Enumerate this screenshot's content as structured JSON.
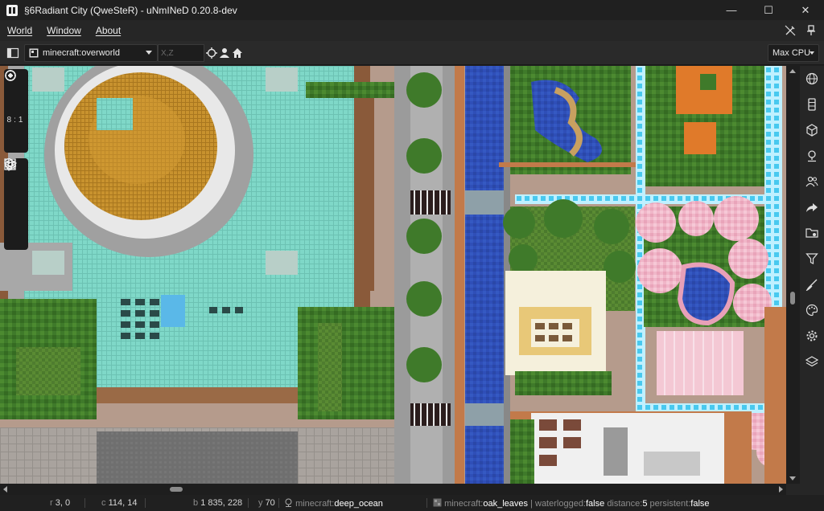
{
  "window": {
    "title": "§6Radiant City (QweSteR) - uNmINeD 0.20.8-dev",
    "controls": {
      "minimize": "—",
      "maximize": "☐",
      "close": "✕"
    }
  },
  "menu": {
    "items": [
      {
        "label": "World"
      },
      {
        "label": "Window"
      },
      {
        "label": "About"
      }
    ],
    "right_icons": [
      "edit-off-icon",
      "pin-icon"
    ]
  },
  "toolbar": {
    "dimension": "minecraft:overworld",
    "coord_placeholder": "X,Z",
    "icons": [
      "crosshair-icon",
      "player-icon",
      "home-icon"
    ],
    "cpu_mode": "Max CPU"
  },
  "map_controls": {
    "zoom_level": "8:1",
    "buttons_top": [
      "center-icon",
      "zoom-in-icon",
      "zoom-out-icon"
    ],
    "buttons_bottom": [
      "grid-icon",
      "marker-icon",
      "light-icon",
      "layers-icon"
    ]
  },
  "right_sidebar": {
    "icons": [
      "globe-icon",
      "database-icon",
      "cube-icon",
      "pin-drop-icon",
      "players-icon",
      "share-icon",
      "folder-settings-icon",
      "filter-icon",
      "brush-icon",
      "palette-icon",
      "settings-icon",
      "layers-icon"
    ]
  },
  "status": {
    "region": {
      "k": "r",
      "v": "3, 0"
    },
    "chunk": {
      "k": "c",
      "v": "114, 14"
    },
    "block": {
      "k": "b",
      "v": "1 835, 228"
    },
    "y": {
      "k": "y",
      "v": "70"
    },
    "biome_ns": "minecraft:",
    "biome": "deep_ocean",
    "block_ns": "minecraft:",
    "block_name": "oak_leaves",
    "props": [
      {
        "k": "waterlogged:",
        "v": "false"
      },
      {
        "k": "distance:",
        "v": "5"
      },
      {
        "k": "persistent:",
        "v": "false"
      }
    ]
  },
  "colors": {
    "cyan_roof": "#7fd8c8",
    "gold_dome": "#c8922e",
    "grass": "#4f7d2f",
    "trees": "#3f7a2a",
    "river": "#2f4fb8",
    "road": "#6f6f6f",
    "cherry": "#f0b6c8"
  }
}
